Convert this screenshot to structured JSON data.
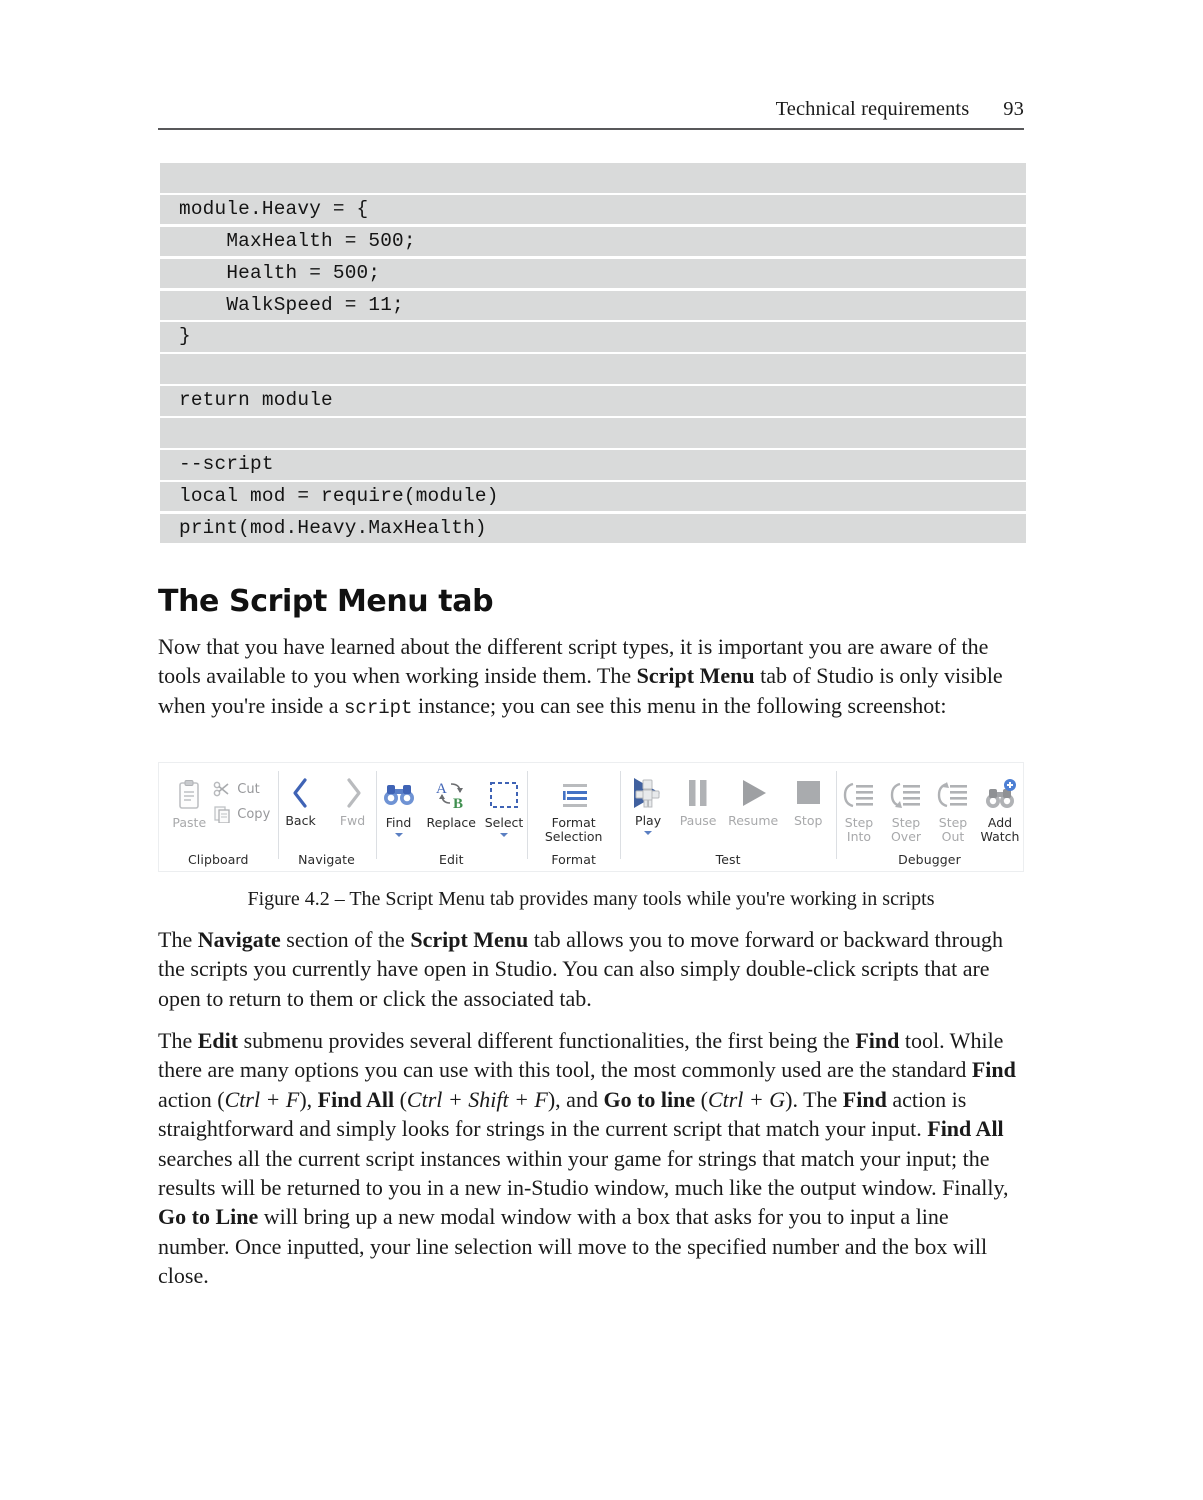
{
  "header": {
    "title": "Technical requirements",
    "page_number": "93"
  },
  "code_block": {
    "language": "lua",
    "lines": [
      "",
      "module.Heavy = {",
      "    MaxHealth = 500;",
      "    Health = 500;",
      "    WalkSpeed = 11;",
      "}",
      "",
      "return module",
      "",
      "--script",
      "local mod = require(module)",
      "print(mod.Heavy.MaxHealth)"
    ]
  },
  "section": {
    "heading": "The Script Menu tab"
  },
  "paragraphs": {
    "p1_a": "Now that you have learned about the different script types, it is important you are aware of the tools available to you when working inside them. The ",
    "p1_b": "Script Menu",
    "p1_c": " tab of Studio is only visible when you're inside a ",
    "p1_d": "script",
    "p1_e": " instance; you can see this menu in the following screenshot:",
    "p3_a": "The ",
    "p3_b": "Navigate",
    "p3_c": " section of the ",
    "p3_d": "Script Menu",
    "p3_e": " tab allows you to move forward or backward through the scripts you currently have open in Studio. You can also simply double-click scripts that are open to return to them or click the associated tab.",
    "p4_a": "The ",
    "p4_b": "Edit",
    "p4_c": " submenu provides several different functionalities, the first being the ",
    "p4_d": "Find",
    "p4_e": " tool. While there are many options you can use with this tool, the most commonly used are the standard ",
    "p4_f": "Find",
    "p4_g": " action (",
    "p4_h": "Ctrl + F",
    "p4_i": "), ",
    "p4_j": "Find All",
    "p4_k": " (",
    "p4_l": "Ctrl + Shift + F",
    "p4_m": "), and ",
    "p4_n": "Go to line",
    "p4_o": " (",
    "p4_p": "Ctrl + G",
    "p4_q": "). The ",
    "p4_r": "Find",
    "p4_s": " action is straightforward and simply looks for strings in the current script that match your input. ",
    "p4_t": "Find All",
    "p4_u": " searches all the current script instances within your game for strings that match your input; the results will be returned to you in a new in-Studio window, much like the output window. Finally, ",
    "p4_v": "Go to Line",
    "p4_w": " will bring up a new modal window with a box that asks for you to input a line number. Once inputted, your line selection will move to the specified number and the box will close."
  },
  "figure": {
    "caption": "Figure 4.2 – The Script Menu tab provides many tools while you're working in scripts",
    "ribbon": {
      "groups": [
        {
          "name": "Clipboard",
          "label": "Clipboard",
          "buttons": [
            {
              "id": "paste",
              "label": "Paste",
              "icon": "clipboard-icon",
              "enabled": false
            },
            {
              "id": "cut",
              "label": "Cut",
              "icon": "scissors-icon",
              "enabled": false
            },
            {
              "id": "copy",
              "label": "Copy",
              "icon": "copy-icon",
              "enabled": false
            }
          ]
        },
        {
          "name": "Navigate",
          "label": "Navigate",
          "buttons": [
            {
              "id": "back",
              "label": "Back",
              "icon": "chevron-left-icon",
              "enabled": true
            },
            {
              "id": "fwd",
              "label": "Fwd",
              "icon": "chevron-right-icon",
              "enabled": false
            }
          ]
        },
        {
          "name": "Edit",
          "label": "Edit",
          "buttons": [
            {
              "id": "find",
              "label": "Find",
              "icon": "binoculars-icon",
              "enabled": true,
              "has_dropdown": true
            },
            {
              "id": "replace",
              "label": "Replace",
              "icon": "replace-a-b-icon",
              "enabled": true
            },
            {
              "id": "select",
              "label": "Select",
              "icon": "dashed-selection-icon",
              "enabled": true,
              "has_dropdown": true
            }
          ]
        },
        {
          "name": "Format",
          "label": "Format",
          "buttons": [
            {
              "id": "format-selection",
              "label": "Format",
              "label2": "Selection",
              "icon": "format-lines-icon",
              "enabled": true,
              "has_dropdown": true
            }
          ]
        },
        {
          "name": "Test",
          "label": "Test",
          "buttons": [
            {
              "id": "play",
              "label": "Play",
              "icon": "play-avatar-icon",
              "enabled": true,
              "has_dropdown": true
            },
            {
              "id": "pause",
              "label": "Pause",
              "icon": "pause-icon",
              "enabled": false
            },
            {
              "id": "resume",
              "label": "Resume",
              "icon": "resume-triangle-icon",
              "enabled": false
            },
            {
              "id": "stop",
              "label": "Stop",
              "icon": "stop-square-icon",
              "enabled": false
            }
          ]
        },
        {
          "name": "Debugger",
          "label": "Debugger",
          "buttons": [
            {
              "id": "step-into",
              "label": "Step",
              "label2": "Into",
              "icon": "step-into-icon",
              "enabled": false
            },
            {
              "id": "step-over",
              "label": "Step",
              "label2": "Over",
              "icon": "step-over-icon",
              "enabled": false
            },
            {
              "id": "step-out",
              "label": "Step",
              "label2": "Out",
              "icon": "step-out-icon",
              "enabled": false
            },
            {
              "id": "add-watch",
              "label": "Add",
              "label2": "Watch",
              "icon": "add-watch-binoculars-icon",
              "enabled": true
            }
          ]
        }
      ]
    }
  },
  "colors": {
    "accent_blue": "#4472c4",
    "icon_gray": "#a6a8ab",
    "code_bg": "#d9dada",
    "rule": "#58585a",
    "green": "#3f8f4f"
  }
}
